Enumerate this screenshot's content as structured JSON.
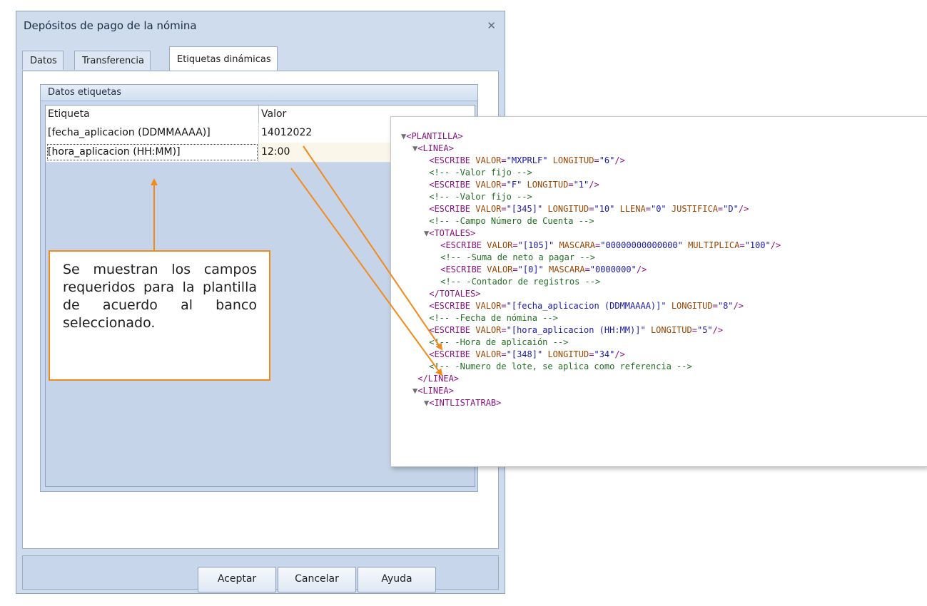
{
  "dialog": {
    "title": "Depósitos de pago de la nómina",
    "close_glyph": "✕",
    "tabs": [
      {
        "label": "Datos",
        "active": false
      },
      {
        "label": "Transferencia",
        "active": false
      },
      {
        "label": "Etiquetas dinámicas",
        "active": true
      }
    ],
    "group_title": "Datos etiquetas",
    "grid": {
      "columns": [
        "Etiqueta",
        "Valor"
      ],
      "rows": [
        {
          "etiqueta": "[fecha_aplicacion (DDMMAAAA)]",
          "valor": "14012022"
        },
        {
          "etiqueta": "[hora_aplicacion (HH:MM)]",
          "valor": "12:00"
        }
      ]
    },
    "buttons": {
      "accept": "Aceptar",
      "cancel": "Cancelar",
      "help": "Ayuda"
    }
  },
  "callout": {
    "text": "Se muestran los campos requeridos para la plantilla de acuerdo al banco seleccionado."
  },
  "xml": {
    "lines": [
      {
        "indent": 0,
        "tri": "▼",
        "parts": [
          [
            "t",
            "<PLANTILLA>"
          ]
        ]
      },
      {
        "indent": 1,
        "tri": "▼",
        "parts": [
          [
            "t",
            "<LINEA>"
          ]
        ]
      },
      {
        "indent": 2,
        "tri": "",
        "parts": [
          [
            "t",
            "<ESCRIBE "
          ],
          [
            "a",
            "VALOR"
          ],
          [
            "t",
            "="
          ],
          [
            "v",
            "\"MXPRLF\""
          ],
          [
            "t",
            " "
          ],
          [
            "a",
            "LONGITUD"
          ],
          [
            "t",
            "="
          ],
          [
            "v",
            "\"6\""
          ],
          [
            "t",
            "/>"
          ]
        ]
      },
      {
        "indent": 2,
        "tri": "",
        "parts": [
          [
            "c",
            "<!-- -Valor fijo -->"
          ]
        ]
      },
      {
        "indent": 2,
        "tri": "",
        "parts": [
          [
            "t",
            "<ESCRIBE "
          ],
          [
            "a",
            "VALOR"
          ],
          [
            "t",
            "="
          ],
          [
            "v",
            "\"F\""
          ],
          [
            "t",
            " "
          ],
          [
            "a",
            "LONGITUD"
          ],
          [
            "t",
            "="
          ],
          [
            "v",
            "\"1\""
          ],
          [
            "t",
            "/>"
          ]
        ]
      },
      {
        "indent": 2,
        "tri": "",
        "parts": [
          [
            "c",
            "<!-- -Valor fijo -->"
          ]
        ]
      },
      {
        "indent": 2,
        "tri": "",
        "parts": [
          [
            "t",
            "<ESCRIBE "
          ],
          [
            "a",
            "VALOR"
          ],
          [
            "t",
            "="
          ],
          [
            "v",
            "\"[345]\""
          ],
          [
            "t",
            " "
          ],
          [
            "a",
            "LONGITUD"
          ],
          [
            "t",
            "="
          ],
          [
            "v",
            "\"10\""
          ],
          [
            "t",
            " "
          ],
          [
            "a",
            "LLENA"
          ],
          [
            "t",
            "="
          ],
          [
            "v",
            "\"0\""
          ],
          [
            "t",
            " "
          ],
          [
            "a",
            "JUSTIFICA"
          ],
          [
            "t",
            "="
          ],
          [
            "v",
            "\"D\""
          ],
          [
            "t",
            "/>"
          ]
        ]
      },
      {
        "indent": 2,
        "tri": "",
        "parts": [
          [
            "c",
            "<!-- -Campo Número de Cuenta -->"
          ]
        ]
      },
      {
        "indent": 2,
        "tri": "▼",
        "parts": [
          [
            "t",
            "<TOTALES>"
          ]
        ]
      },
      {
        "indent": 3,
        "tri": "",
        "parts": [
          [
            "t",
            "<ESCRIBE "
          ],
          [
            "a",
            "VALOR"
          ],
          [
            "t",
            "="
          ],
          [
            "v",
            "\"[105]\""
          ],
          [
            "t",
            " "
          ],
          [
            "a",
            "MASCARA"
          ],
          [
            "t",
            "="
          ],
          [
            "v",
            "\"00000000000000\""
          ],
          [
            "t",
            " "
          ],
          [
            "a",
            "MULTIPLICA"
          ],
          [
            "t",
            "="
          ],
          [
            "v",
            "\"100\""
          ],
          [
            "t",
            "/>"
          ]
        ]
      },
      {
        "indent": 3,
        "tri": "",
        "parts": [
          [
            "c",
            "<!-- -Suma de neto a pagar -->"
          ]
        ]
      },
      {
        "indent": 3,
        "tri": "",
        "parts": [
          [
            "t",
            "<ESCRIBE "
          ],
          [
            "a",
            "VALOR"
          ],
          [
            "t",
            "="
          ],
          [
            "v",
            "\"[0]\""
          ],
          [
            "t",
            " "
          ],
          [
            "a",
            "MASCARA"
          ],
          [
            "t",
            "="
          ],
          [
            "v",
            "\"0000000\""
          ],
          [
            "t",
            "/>"
          ]
        ]
      },
      {
        "indent": 3,
        "tri": "",
        "parts": [
          [
            "c",
            "<!-- -Contador de registros -->"
          ]
        ]
      },
      {
        "indent": 2,
        "tri": "",
        "parts": [
          [
            "t",
            "</TOTALES>"
          ]
        ]
      },
      {
        "indent": 2,
        "tri": "",
        "parts": [
          [
            "t",
            "<ESCRIBE "
          ],
          [
            "a",
            "VALOR"
          ],
          [
            "t",
            "="
          ],
          [
            "v",
            "\"[fecha_aplicacion (DDMMAAAA)]\""
          ],
          [
            "t",
            " "
          ],
          [
            "a",
            "LONGITUD"
          ],
          [
            "t",
            "="
          ],
          [
            "v",
            "\"8\""
          ],
          [
            "t",
            "/>"
          ]
        ]
      },
      {
        "indent": 2,
        "tri": "",
        "parts": [
          [
            "c",
            "<!-- -Fecha de nómina -->"
          ]
        ]
      },
      {
        "indent": 2,
        "tri": "",
        "parts": [
          [
            "t",
            "<ESCRIBE "
          ],
          [
            "a",
            "VALOR"
          ],
          [
            "t",
            "="
          ],
          [
            "v",
            "\"[hora_aplicacion (HH:MM)]\""
          ],
          [
            "t",
            " "
          ],
          [
            "a",
            "LONGITUD"
          ],
          [
            "t",
            "="
          ],
          [
            "v",
            "\"5\""
          ],
          [
            "t",
            "/>"
          ]
        ]
      },
      {
        "indent": 2,
        "tri": "",
        "parts": [
          [
            "c",
            "<!-- -Hora de aplicaión -->"
          ]
        ]
      },
      {
        "indent": 2,
        "tri": "",
        "parts": [
          [
            "t",
            "<ESCRIBE "
          ],
          [
            "a",
            "VALOR"
          ],
          [
            "t",
            "="
          ],
          [
            "v",
            "\"[348]\""
          ],
          [
            "t",
            " "
          ],
          [
            "a",
            "LONGITUD"
          ],
          [
            "t",
            "="
          ],
          [
            "v",
            "\"34\""
          ],
          [
            "t",
            "/>"
          ]
        ]
      },
      {
        "indent": 2,
        "tri": "",
        "parts": [
          [
            "c",
            "<!-- -Numero de lote, se aplica como referencia -->"
          ]
        ]
      },
      {
        "indent": 1,
        "tri": "",
        "parts": [
          [
            "t",
            "</LINEA>"
          ]
        ]
      },
      {
        "indent": 1,
        "tri": "▼",
        "parts": [
          [
            "t",
            "<LINEA>"
          ]
        ]
      },
      {
        "indent": 2,
        "tri": "▼",
        "parts": [
          [
            "t",
            "<INTLISTATRAB>"
          ]
        ]
      }
    ]
  },
  "colors": {
    "accent_orange": "#f28a1c",
    "xml_tag": "#881280",
    "xml_attr": "#994500",
    "xml_value": "#1a1aa6",
    "xml_comment": "#236e25"
  }
}
